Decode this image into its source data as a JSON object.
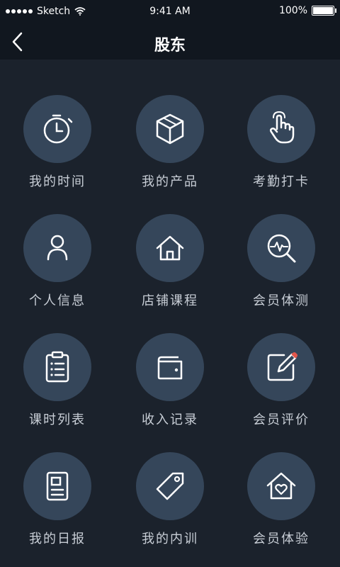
{
  "status_bar": {
    "carrier": "Sketch",
    "time": "9:41 AM",
    "battery": "100%"
  },
  "nav": {
    "title": "股东",
    "back_icon": "chevron-left-icon"
  },
  "menu": {
    "items": [
      {
        "label": "我的时间",
        "icon": "stopwatch-icon"
      },
      {
        "label": "我的产品",
        "icon": "cube-icon"
      },
      {
        "label": "考勤打卡",
        "icon": "finger-tap-icon"
      },
      {
        "label": "个人信息",
        "icon": "person-icon"
      },
      {
        "label": "店铺课程",
        "icon": "home-icon"
      },
      {
        "label": "会员体测",
        "icon": "magnifier-pulse-icon"
      },
      {
        "label": "课时列表",
        "icon": "clipboard-list-icon"
      },
      {
        "label": "收入记录",
        "icon": "wallet-icon"
      },
      {
        "label": "会员评价",
        "icon": "edit-pencil-icon"
      },
      {
        "label": "我的日报",
        "icon": "report-doc-icon"
      },
      {
        "label": "我的内训",
        "icon": "tag-icon"
      },
      {
        "label": "会员体验",
        "icon": "heart-house-icon"
      }
    ]
  },
  "colors": {
    "background": "#1b222c",
    "bar": "#11171f",
    "icon_circle": "#35465a",
    "label": "#c8ced6"
  }
}
